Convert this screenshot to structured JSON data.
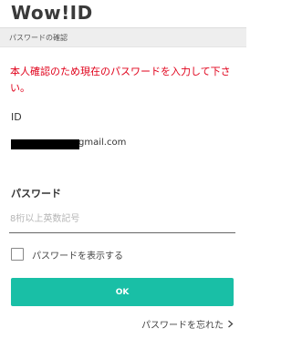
{
  "header": {
    "logo_text": "Wow!ID",
    "subtitle": "パスワードの確認"
  },
  "form": {
    "error_message": "本人確認のため現在のパスワードを入力して下さい。",
    "id_label": "ID",
    "id_value_visible": "gmail.com",
    "password_label": "パスワード",
    "password_placeholder": "8桁以上英数記号",
    "password_value": "",
    "show_password_label": "パスワードを表示する",
    "show_password_checked": false,
    "ok_label": "OK",
    "forgot_password_label": "パスワードを忘れた"
  },
  "colors": {
    "accent": "#19bfa6",
    "error": "#e0001a"
  },
  "icons": {
    "forgot_arrow": "chevron-right-icon"
  }
}
